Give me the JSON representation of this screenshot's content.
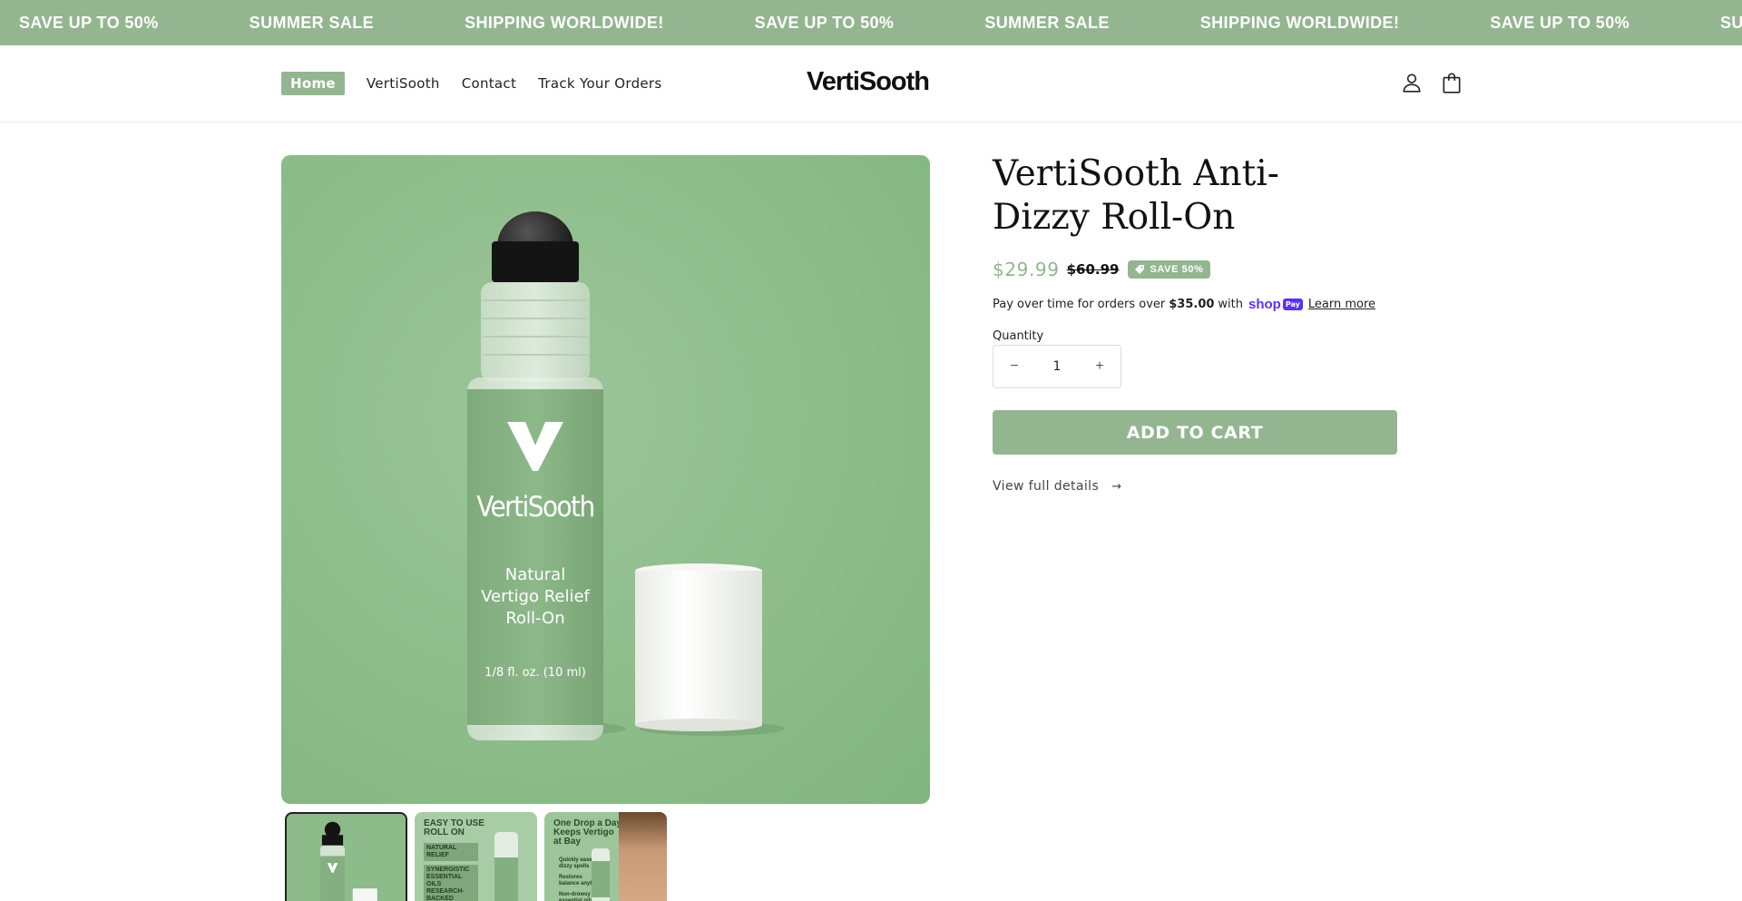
{
  "marquee": {
    "items": [
      "SAVE UP TO 50%",
      "SUMMER SALE",
      "SHIPPING WORLDWIDE!",
      "SAVE UP TO 50%",
      "SUMMER SALE",
      "SHIPPING WORLDWIDE!",
      "SAVE UP TO 50%",
      "SUMMER"
    ]
  },
  "header": {
    "nav": [
      "Home",
      "VertiSooth",
      "Contact",
      "Track Your Orders"
    ],
    "logo": "VertiSooth",
    "icons": [
      "account-icon",
      "cart-icon"
    ]
  },
  "gallery": {
    "main": {
      "brand": "VertiSooth",
      "label_lines": [
        "Natural",
        "Vertigo Relief",
        "Roll-On"
      ],
      "volume": "1/8 fl. oz. (10 ml)"
    },
    "thumbnails": [
      {
        "caption": ""
      },
      {
        "caption": "EASY TO USE ROLL ON",
        "bullets": [
          "NATURAL RELIEF",
          "SYNERGISTIC ESSENTIAL OILS",
          "RESEARCH-BACKED"
        ]
      },
      {
        "caption": "One Drop a Day Keeps Vertigo at Bay",
        "bullets": [
          "Quickly eases dizzy spells",
          "Restores balance anytime",
          "Non-drowsy essential oils"
        ]
      }
    ]
  },
  "product": {
    "title": "VertiSooth Anti-Dizzy Roll-On",
    "price_sale": "$29.99",
    "price_regular": "$60.99",
    "badge": "SAVE 50%",
    "installments": {
      "prefix": "Pay over time for orders over",
      "amount": "$35.00",
      "with": "with",
      "provider_word": "shop",
      "provider_pay": "Pay",
      "learn_more": "Learn more"
    },
    "quantity_label": "Quantity",
    "quantity_value": "1",
    "add_to_cart": "ADD TO CART",
    "view_details": "View full details",
    "view_details_arrow": "→"
  },
  "colors": {
    "accent": "#93b690",
    "shop_pay": "#5a31f4"
  }
}
